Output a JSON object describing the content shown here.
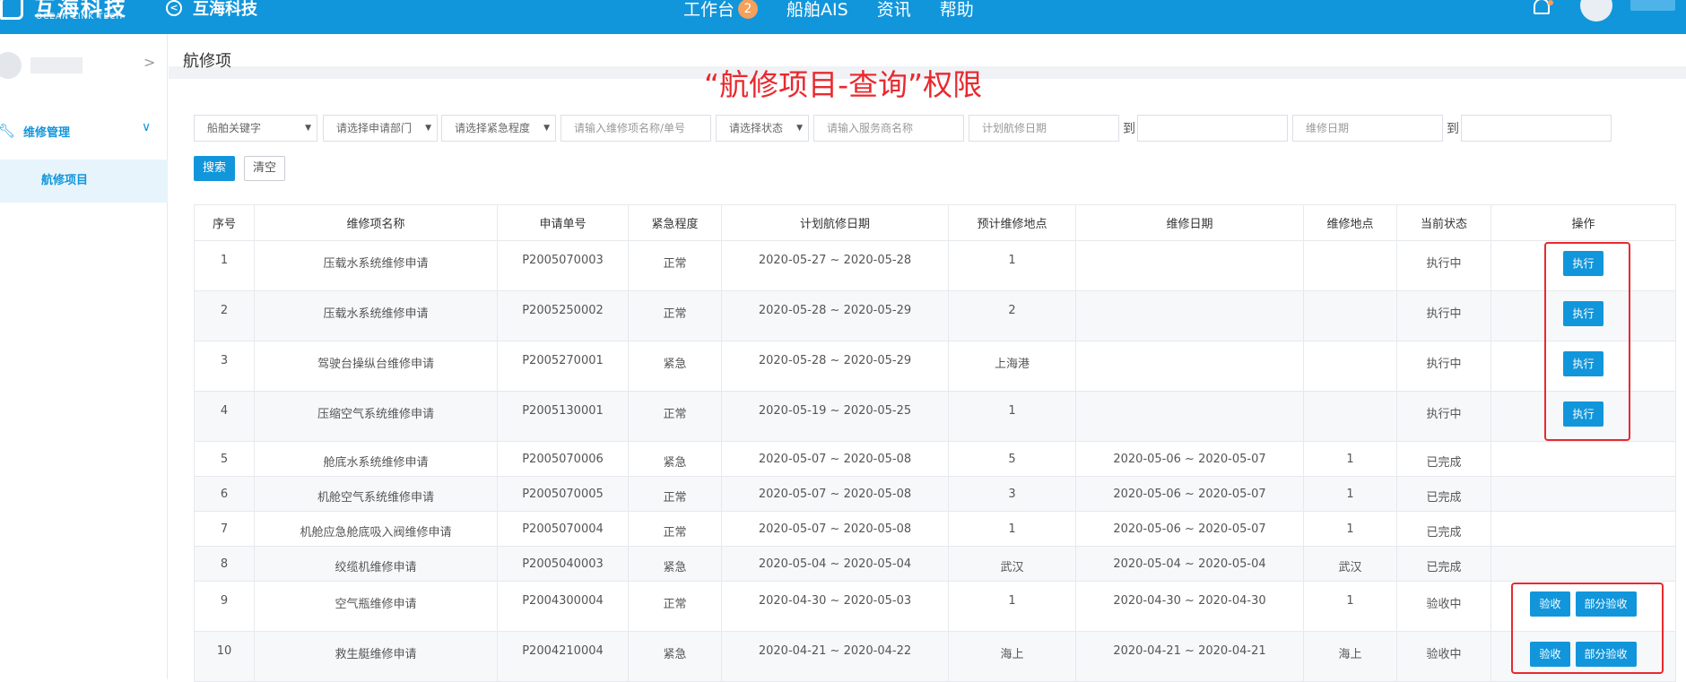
{
  "topbar": {
    "logo_cn": "互海科技",
    "logo_en": "OCEAN LINK TECH",
    "app_title": "互海科技",
    "nav": [
      {
        "label": "工作台",
        "badge": "2"
      },
      {
        "label": "船舶AIS"
      },
      {
        "label": "资讯"
      },
      {
        "label": "帮助"
      }
    ]
  },
  "sidebar": {
    "menu_label": "维修管理",
    "sub_label": "航修项目"
  },
  "page": {
    "title": "航修项",
    "annotation": "“航修项目-查询”权限"
  },
  "filters": {
    "ship_keyword": "船舶关键字",
    "dept": "请选择申请部门",
    "urgency": "请选择紧急程度",
    "item_name_placeholder": "请输入维修项名称/单号",
    "status": "请选择状态",
    "service_placeholder": "请输入服务商名称",
    "plan_date_placeholder": "计划航修日期",
    "to1": "到",
    "repair_date_placeholder": "维修日期",
    "to2": "到",
    "search": "搜索",
    "clear": "清空"
  },
  "table": {
    "headers": [
      "序号",
      "维修项名称",
      "申请单号",
      "紧急程度",
      "计划航修日期",
      "预计维修地点",
      "维修日期",
      "维修地点",
      "当前状态",
      "操作"
    ],
    "rows": [
      {
        "no": "1",
        "name": "压载水系统维修申请",
        "order": "P2005070003",
        "urgency": "正常",
        "plan": "2020-05-27 ~ 2020-05-28",
        "est_loc": "1",
        "repair_date": "",
        "loc": "",
        "status": "执行中",
        "actions": [
          "执行"
        ]
      },
      {
        "no": "2",
        "name": "压载水系统维修申请",
        "order": "P2005250002",
        "urgency": "正常",
        "plan": "2020-05-28 ~ 2020-05-29",
        "est_loc": "2",
        "repair_date": "",
        "loc": "",
        "status": "执行中",
        "actions": [
          "执行"
        ]
      },
      {
        "no": "3",
        "name": "驾驶台操纵台维修申请",
        "order": "P2005270001",
        "urgency": "紧急",
        "plan": "2020-05-28 ~ 2020-05-29",
        "est_loc": "上海港",
        "repair_date": "",
        "loc": "",
        "status": "执行中",
        "actions": [
          "执行"
        ]
      },
      {
        "no": "4",
        "name": "压缩空气系统维修申请",
        "order": "P2005130001",
        "urgency": "正常",
        "plan": "2020-05-19 ~ 2020-05-25",
        "est_loc": "1",
        "repair_date": "",
        "loc": "",
        "status": "执行中",
        "actions": [
          "执行"
        ]
      },
      {
        "no": "5",
        "name": "舱底水系统维修申请",
        "order": "P2005070006",
        "urgency": "紧急",
        "plan": "2020-05-07 ~ 2020-05-08",
        "est_loc": "5",
        "repair_date": "2020-05-06 ~ 2020-05-07",
        "loc": "1",
        "status": "已完成",
        "actions": []
      },
      {
        "no": "6",
        "name": "机舱空气系统维修申请",
        "order": "P2005070005",
        "urgency": "正常",
        "plan": "2020-05-07 ~ 2020-05-08",
        "est_loc": "3",
        "repair_date": "2020-05-06 ~ 2020-05-07",
        "loc": "1",
        "status": "已完成",
        "actions": []
      },
      {
        "no": "7",
        "name": "机舱应急舱底吸入阀维修申请",
        "order": "P2005070004",
        "urgency": "正常",
        "plan": "2020-05-07 ~ 2020-05-08",
        "est_loc": "1",
        "repair_date": "2020-05-06 ~ 2020-05-07",
        "loc": "1",
        "status": "已完成",
        "actions": []
      },
      {
        "no": "8",
        "name": "绞缆机维修申请",
        "order": "P2005040003",
        "urgency": "紧急",
        "plan": "2020-05-04 ~ 2020-05-04",
        "est_loc": "武汉",
        "repair_date": "2020-05-04 ~ 2020-05-04",
        "loc": "武汉",
        "status": "已完成",
        "actions": []
      },
      {
        "no": "9",
        "name": "空气瓶维修申请",
        "order": "P2004300004",
        "urgency": "正常",
        "plan": "2020-04-30 ~ 2020-05-03",
        "est_loc": "1",
        "repair_date": "2020-04-30 ~ 2020-04-30",
        "loc": "1",
        "status": "验收中",
        "actions": [
          "验收",
          "部分验收"
        ]
      },
      {
        "no": "10",
        "name": "救生艇维修申请",
        "order": "P2004210004",
        "urgency": "紧急",
        "plan": "2020-04-21 ~ 2020-04-22",
        "est_loc": "海上",
        "repair_date": "2020-04-21 ~ 2020-04-21",
        "loc": "海上",
        "status": "验收中",
        "actions": [
          "验收",
          "部分验收"
        ]
      }
    ]
  },
  "colors": {
    "brand": "#1296db",
    "annotation_red": "#e8292e",
    "badge": "#f5a05b"
  }
}
